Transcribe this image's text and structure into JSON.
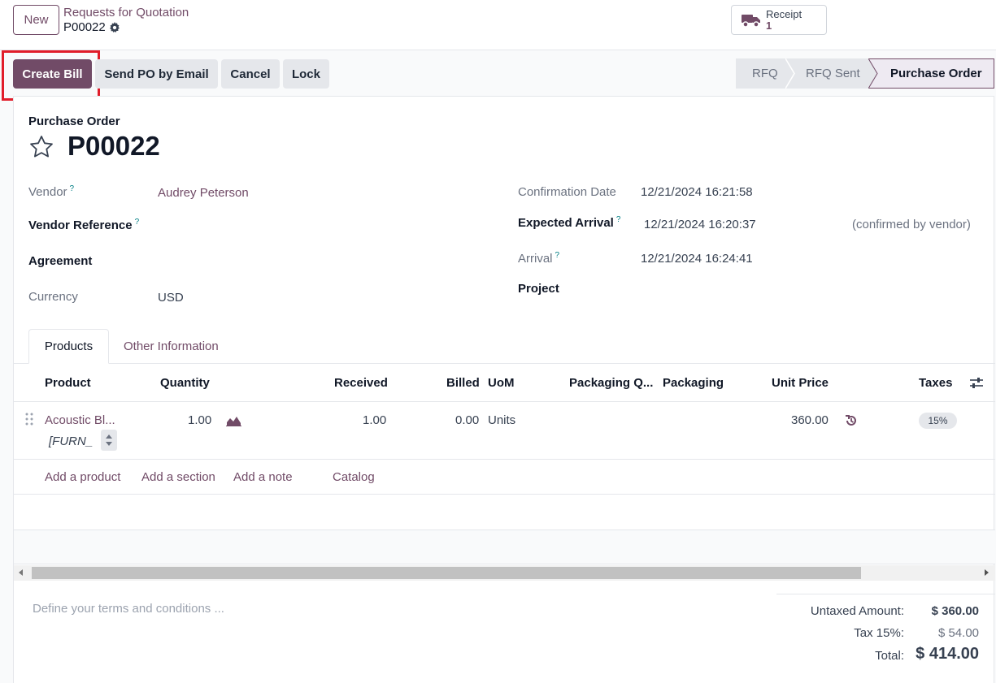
{
  "topbar": {
    "new_label": "New",
    "breadcrumb_parent": "Requests for Quotation",
    "breadcrumb_current": "P00022",
    "receipt_label": "Receipt",
    "receipt_count": "1"
  },
  "actions": {
    "create_bill": "Create Bill",
    "send_po": "Send PO by Email",
    "cancel": "Cancel",
    "lock": "Lock"
  },
  "statusbar": {
    "stages": [
      "RFQ",
      "RFQ Sent",
      "Purchase Order"
    ],
    "current": "Purchase Order"
  },
  "form": {
    "doc_label": "Purchase Order",
    "doc_number": "P00022",
    "vendor_label": "Vendor",
    "vendor_value": "Audrey Peterson",
    "vendor_ref_label": "Vendor Reference",
    "agreement_label": "Agreement",
    "currency_label": "Currency",
    "currency_value": "USD",
    "confirmation_label": "Confirmation Date",
    "confirmation_value": "12/21/2024 16:21:58",
    "expected_label": "Expected Arrival",
    "expected_value": "12/21/2024 16:20:37",
    "expected_note": "(confirmed by vendor)",
    "arrival_label": "Arrival",
    "arrival_value": "12/21/2024 16:24:41",
    "project_label": "Project",
    "tooltip_mark": "?"
  },
  "tabs": [
    "Products",
    "Other Information"
  ],
  "table": {
    "headers": {
      "product": "Product",
      "quantity": "Quantity",
      "received": "Received",
      "billed": "Billed",
      "uom": "UoM",
      "packaging_qty": "Packaging Q...",
      "packaging": "Packaging",
      "unit_price": "Unit Price",
      "taxes": "Taxes"
    },
    "rows": [
      {
        "product": "Acoustic Bl...",
        "internal_ref": "[FURN_",
        "quantity": "1.00",
        "received": "1.00",
        "billed": "0.00",
        "uom": "Units",
        "unit_price": "360.00",
        "tax": "15%"
      }
    ],
    "add_links": {
      "product": "Add a product",
      "section": "Add a section",
      "note": "Add a note",
      "catalog": "Catalog"
    }
  },
  "footer": {
    "terms_placeholder": "Define your terms and conditions ...",
    "untaxed_label": "Untaxed Amount:",
    "untaxed_value": "$ 360.00",
    "tax_label": "Tax 15%:",
    "tax_value": "$ 54.00",
    "total_label": "Total:",
    "total_value": "$ 414.00"
  },
  "colors": {
    "brand": "#714b67",
    "highlight": "#e11d2a"
  }
}
